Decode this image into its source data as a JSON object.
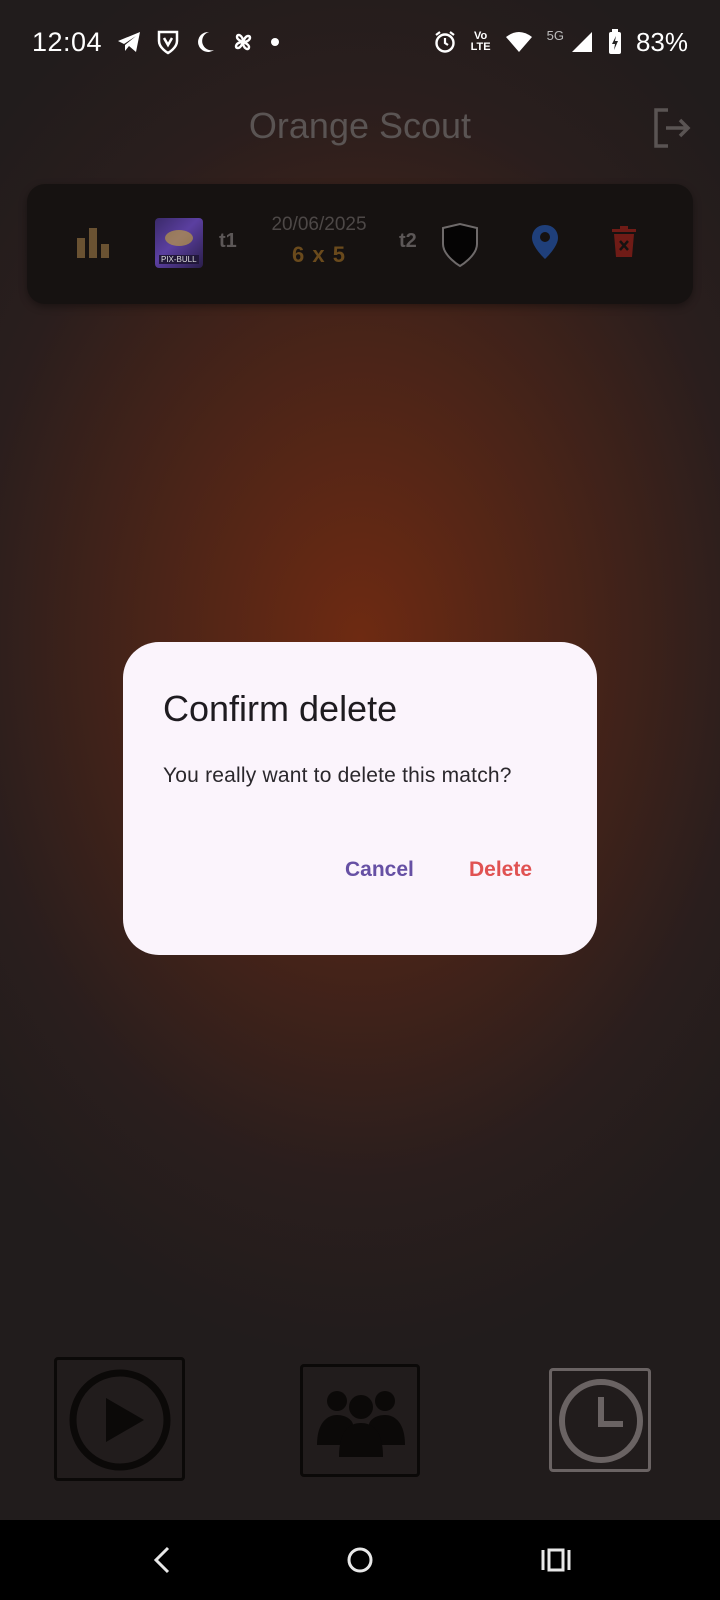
{
  "status_bar": {
    "time": "12:04",
    "volte_top": "Vo",
    "volte_bottom": "LTE",
    "network": "5G",
    "battery": "83%"
  },
  "app_bar": {
    "title": "Orange Scout",
    "logout_icon": "logout-icon"
  },
  "match": {
    "team1_label": "t1",
    "team1_logo_text": "PIX-BULL",
    "date": "20/06/2025",
    "score": "6 x 5",
    "team2_label": "t2",
    "icons": [
      "stats-icon",
      "team2-shield-icon",
      "location-icon",
      "delete-icon"
    ],
    "colors": {
      "stats": "#6a5232",
      "location": "#1f3f7a",
      "delete": "#6f1b16"
    }
  },
  "dialog": {
    "title": "Confirm delete",
    "message": "You really want to delete this match?",
    "cancel_label": "Cancel",
    "delete_label": "Delete",
    "colors": {
      "background": "#fbf4fc",
      "cancel": "#6650a4",
      "delete": "#e05252"
    }
  },
  "bottom_nav": {
    "items": [
      "play-icon",
      "team-icon",
      "clock-icon"
    ]
  },
  "system_nav": {
    "items": [
      "back-icon",
      "home-icon",
      "recents-icon"
    ]
  }
}
